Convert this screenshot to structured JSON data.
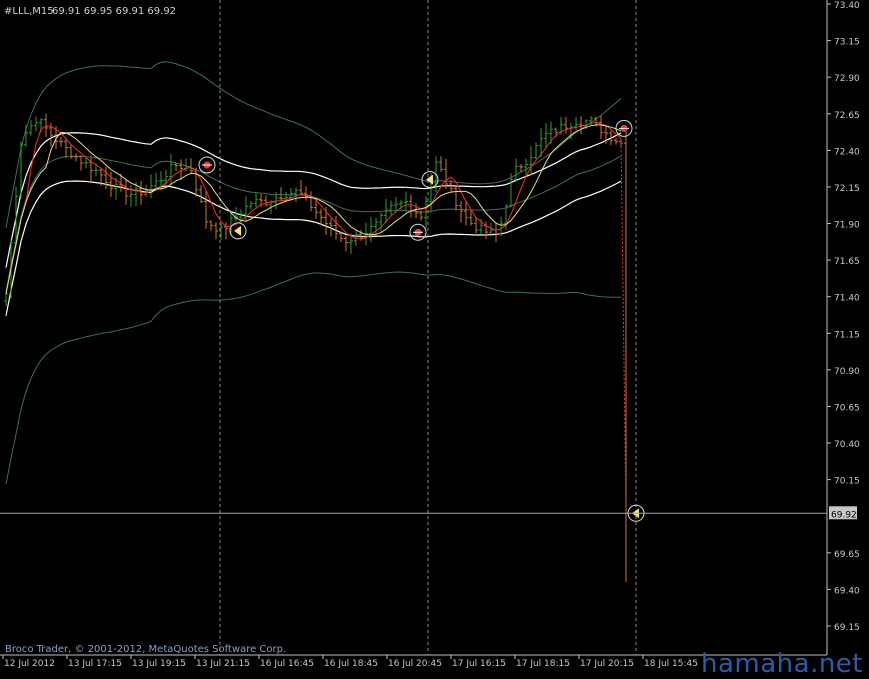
{
  "header": {
    "symbol_timeframe": "#LLL,M15",
    "ohlc_readout": "69.91 69.95 69.91 69.92"
  },
  "copyright": "Broco Trader, © 2001-2012, MetaQuotes Software Corp.",
  "watermark": "hamaha.net",
  "price_axis": {
    "ticks": [
      "73.40",
      "73.15",
      "72.90",
      "72.65",
      "72.40",
      "72.15",
      "71.90",
      "71.65",
      "71.40",
      "71.15",
      "70.90",
      "70.65",
      "70.40",
      "70.15",
      "69.65",
      "69.40",
      "69.15"
    ],
    "current_price": "69.92"
  },
  "time_axis": {
    "ticks": [
      "12 Jul 2012",
      "13 Jul 17:15",
      "13 Jul 19:15",
      "13 Jul 21:15",
      "16 Jul 16:45",
      "16 Jul 18:45",
      "16 Jul 20:45",
      "17 Jul 16:15",
      "17 Jul 18:15",
      "17 Jul 20:15",
      "18 Jul 15:45"
    ]
  },
  "colors": {
    "background": "#000000",
    "axis": "#c0c0c0",
    "grid_separator": "#b0b0b0",
    "bull_bar": "#2e9f2e",
    "bear_bar": "#d07828",
    "ma_fast": "#ff2a2a",
    "ma_slow": "#e8e07a",
    "envelope": "#ffffff",
    "bollinger": "#3f6f58",
    "current_price_line": "#8fa8c0"
  },
  "chart_data": {
    "type": "ohlc",
    "y_range": [
      69.02,
      73.4
    ],
    "day_separators": [
      "13 Jul 21:15",
      "16 Jul 20:45",
      "17 Jul 22:15"
    ],
    "close_path": [
      71.42,
      72.48,
      72.62,
      72.5,
      72.4,
      72.32,
      72.25,
      72.15,
      72.1,
      72.12,
      72.2,
      72.3,
      72.28,
      71.92,
      71.85,
      71.95,
      72.05,
      72.05,
      72.1,
      72.12,
      72.0,
      71.88,
      71.78,
      71.82,
      71.88,
      72.0,
      72.05,
      71.95,
      72.32,
      72.1,
      71.92,
      71.85,
      71.82,
      72.25,
      72.35,
      72.5,
      72.55,
      72.6,
      72.6,
      72.52,
      72.45,
      69.92
    ],
    "markers": [
      {
        "type": "sell",
        "price": 72.3
      },
      {
        "type": "buy",
        "price": 71.85
      },
      {
        "type": "sell",
        "price": 71.84
      },
      {
        "type": "buy",
        "price": 72.2
      },
      {
        "type": "sell",
        "price": 72.55
      },
      {
        "type": "buy",
        "price": 69.92
      }
    ]
  }
}
